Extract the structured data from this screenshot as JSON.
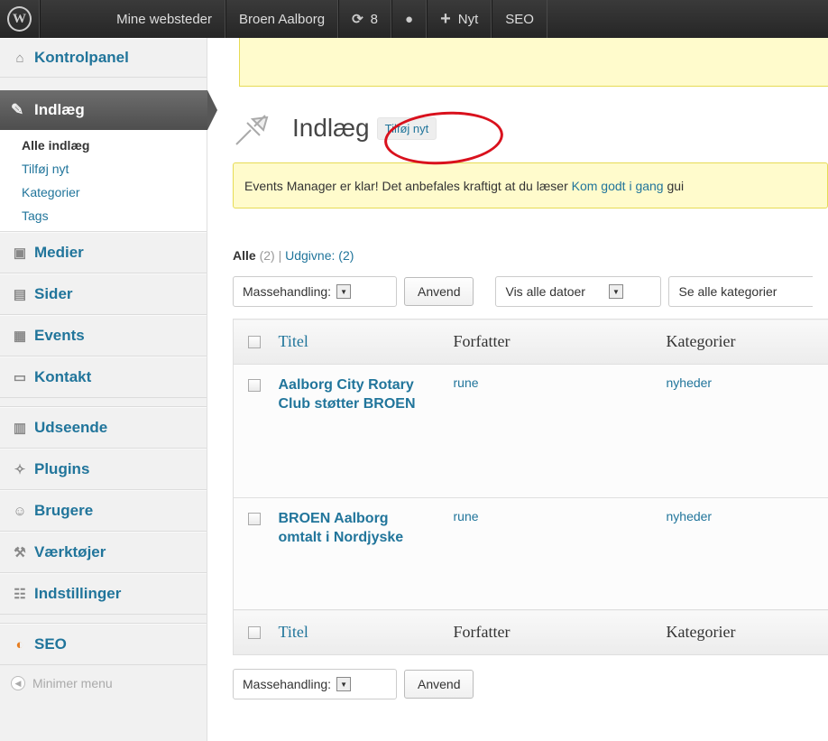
{
  "adminbar": {
    "sites": "Mine websteder",
    "site_name": "Broen Aalborg",
    "updates_count": "8",
    "new_label": "Nyt",
    "seo_label": "SEO"
  },
  "sidebar": {
    "dashboard": "Kontrolpanel",
    "posts": "Indlæg",
    "posts_sub": [
      "Alle indlæg",
      "Tilføj nyt",
      "Kategorier",
      "Tags"
    ],
    "media": "Medier",
    "pages": "Sider",
    "events": "Events",
    "contact": "Kontakt",
    "appearance": "Udseende",
    "plugins": "Plugins",
    "users": "Brugere",
    "tools": "Værktøjer",
    "settings": "Indstillinger",
    "seo": "SEO",
    "collapse": "Minimer menu"
  },
  "main": {
    "title": "Indlæg",
    "add_new": "Tilføj nyt",
    "notice_text": "Events Manager er klar! Det anbefales kraftigt at du læser ",
    "notice_link": "Kom godt i gang",
    "notice_tail": " gui",
    "filter_all": "Alle",
    "filter_all_count": "(2)",
    "filter_published": "Udgivne:",
    "filter_published_count": "(2)",
    "bulk_action": "Massehandling:",
    "apply": "Anvend",
    "dates": "Vis alle datoer",
    "categories": "Se alle kategorier"
  },
  "table": {
    "columns": [
      "Titel",
      "Forfatter",
      "Kategorier"
    ],
    "rows": [
      {
        "title": "Aalborg City Rotary Club støtter BROEN",
        "author": "rune",
        "category": "nyheder"
      },
      {
        "title": "BROEN Aalborg omtalt i Nordjyske",
        "author": "rune",
        "category": "nyheder"
      }
    ]
  }
}
